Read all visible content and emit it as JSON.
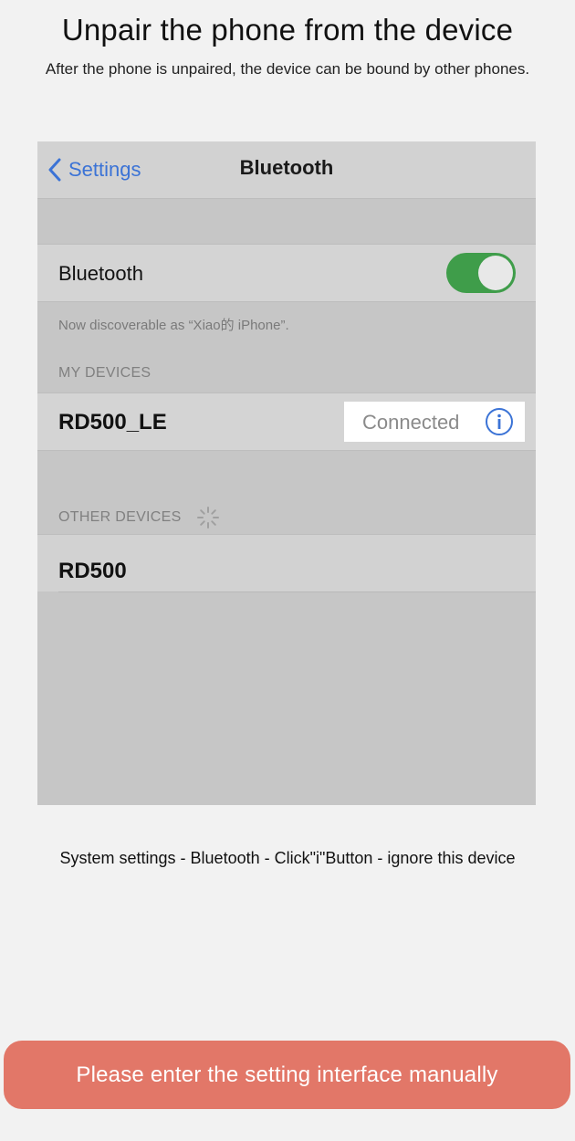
{
  "header": {
    "title": "Unpair the phone from the device",
    "subtitle": "After the phone is unpaired, the device can be bound by other phones."
  },
  "settings_mock": {
    "nav": {
      "back_label": "Settings",
      "back_icon": "chevron-left-icon",
      "title": "Bluetooth"
    },
    "bluetooth_row": {
      "label": "Bluetooth",
      "toggle_on": true
    },
    "discoverable_note": "Now discoverable as “Xiao的 iPhone”.",
    "my_devices": {
      "header": "MY DEVICES",
      "devices": [
        {
          "name": "RD500_LE",
          "status": "Connected",
          "icon": "info-icon"
        }
      ]
    },
    "other_devices": {
      "header": "OTHER DEVICES",
      "devices": [
        {
          "name": "RD500"
        }
      ]
    }
  },
  "instructions": "System settings - Bluetooth - Click\"i\"Button - ignore this device",
  "cta_label": "Please enter the setting interface manually",
  "colors": {
    "accent_blue": "#3b73d6",
    "toggle_green": "#3f9d4a",
    "cta_red": "#e27768"
  }
}
